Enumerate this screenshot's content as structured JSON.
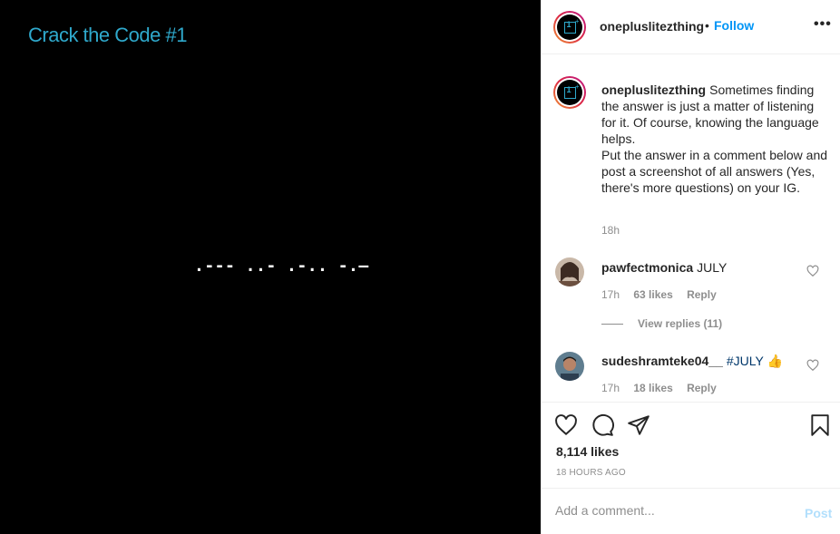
{
  "post_media": {
    "title": "Crack the Code #1",
    "morse": ".--- ..- .-.. -.—"
  },
  "header": {
    "username": "onepluslitezthing",
    "separator": "•",
    "follow_label": "Follow",
    "more_icon": "more-horizontal-icon",
    "more_label": "•••"
  },
  "caption": {
    "username": "onepluslitezthing",
    "lines": [
      "Sometimes finding the answer is just a matter of listening for it. Of course, knowing the language helps.",
      "Put the answer in a comment below and post a screenshot of all answers (Yes, there's more questions) on your IG."
    ],
    "time": "18h"
  },
  "comments": [
    {
      "username": "pawfectmonica",
      "text": "JULY",
      "time": "17h",
      "likes": "63 likes",
      "reply_label": "Reply",
      "view_replies": "View replies (11)"
    },
    {
      "username": "sudeshramteke04__",
      "hashtag": "#JULY",
      "emoji": "👍",
      "time": "17h",
      "likes": "18 likes",
      "reply_label": "Reply"
    }
  ],
  "actions": {
    "like_icon": "heart-icon",
    "comment_icon": "comment-icon",
    "share_icon": "share-icon",
    "save_icon": "bookmark-icon",
    "likes_count": "8,114 likes",
    "time_ago": "18 HOURS AGO"
  },
  "add_comment": {
    "placeholder": "Add a comment...",
    "post_label": "Post"
  },
  "colors": {
    "brand_cyan": "#2fa9cc",
    "link_blue": "#0095f6",
    "post_disabled": "#b2dffc",
    "hashtag": "#00376b"
  }
}
